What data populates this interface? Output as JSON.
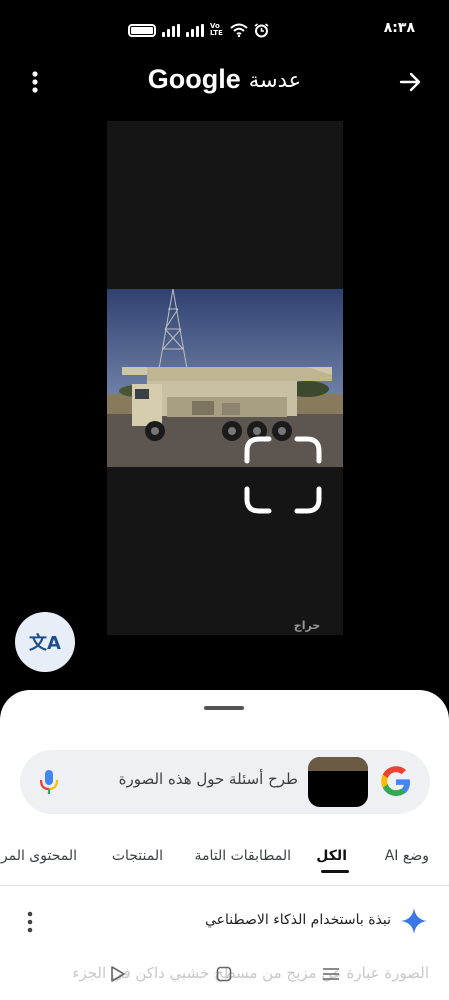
{
  "status_bar": {
    "time": "٨:٣٨",
    "volte": "Vo LTE",
    "icons": [
      "battery-icon",
      "signal-icon",
      "signal-icon",
      "volte-icon",
      "wifi-icon",
      "alarm-icon"
    ]
  },
  "header": {
    "title_brand": "Google",
    "title_app": "عدسة",
    "menu_icon": "more-vertical-icon",
    "forward_icon": "arrow-forward-icon"
  },
  "image": {
    "watermark": "حراج",
    "subject": "drilling-rig-truck"
  },
  "translate_button": {
    "icon": "translate-icon",
    "glyph": "文A"
  },
  "sheet": {
    "search": {
      "placeholder": "طرح أسئلة حول هذه الصورة",
      "mic_icon": "mic-icon",
      "logo_icon": "google-g-icon"
    },
    "tabs": [
      {
        "label": "وضع AI",
        "active": false
      },
      {
        "label": "الكل",
        "active": true
      },
      {
        "label": "المطابقات التامة",
        "active": false
      },
      {
        "label": "المنتجات",
        "active": false
      },
      {
        "label": "المحتوى المر",
        "active": false
      }
    ],
    "ai_overview": {
      "title": "نبذة باستخدام الذكاء الاصطناعي",
      "body": "الصورة عبارة عن مزيج من مسطح خشبي داكن في الجزء",
      "spark_icon": "ai-sparkle-icon",
      "more_icon": "more-vertical-icon"
    }
  },
  "nav_bar": {
    "back_icon": "nav-back-icon",
    "home_icon": "nav-home-icon",
    "recents_icon": "nav-recents-icon"
  },
  "colors": {
    "background": "#000000",
    "sheet": "#ffffff",
    "search_bg": "#eef0f4",
    "google_blue": "#4285F4",
    "google_red": "#EA4335",
    "google_yellow": "#FBBC05",
    "google_green": "#34A853"
  }
}
